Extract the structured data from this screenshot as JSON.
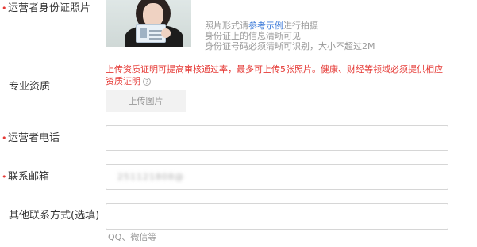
{
  "id_photo": {
    "label": "运营者身份证照片",
    "required_mark": "•",
    "hint_prefix": "照片形式请",
    "hint_link": "参考示例",
    "hint_suffix": "进行拍摄",
    "hint_line2": "身份证上的信息清晰可见",
    "hint_line3": "身份证号码必须清晰可识别，大小不超过2M"
  },
  "qualification": {
    "label": "专业资质",
    "warning": "上传资质证明可提高审核通过率，最多可上传5张照片。健康、财经等领域必须提供相应资质证明",
    "help_icon": "?",
    "upload_button": "上传图片"
  },
  "phone": {
    "label": "运营者电话",
    "required_mark": "•",
    "value": ""
  },
  "email": {
    "label": "联系邮箱",
    "required_mark": "•",
    "value": "251121808@"
  },
  "other_contact": {
    "label": "其他联系方式(选填)",
    "value": "",
    "hint": "QQ、微信等"
  },
  "colors": {
    "required": "#e53935",
    "warning": "#e53935",
    "link": "#3d7bd9",
    "hint": "#999999"
  }
}
